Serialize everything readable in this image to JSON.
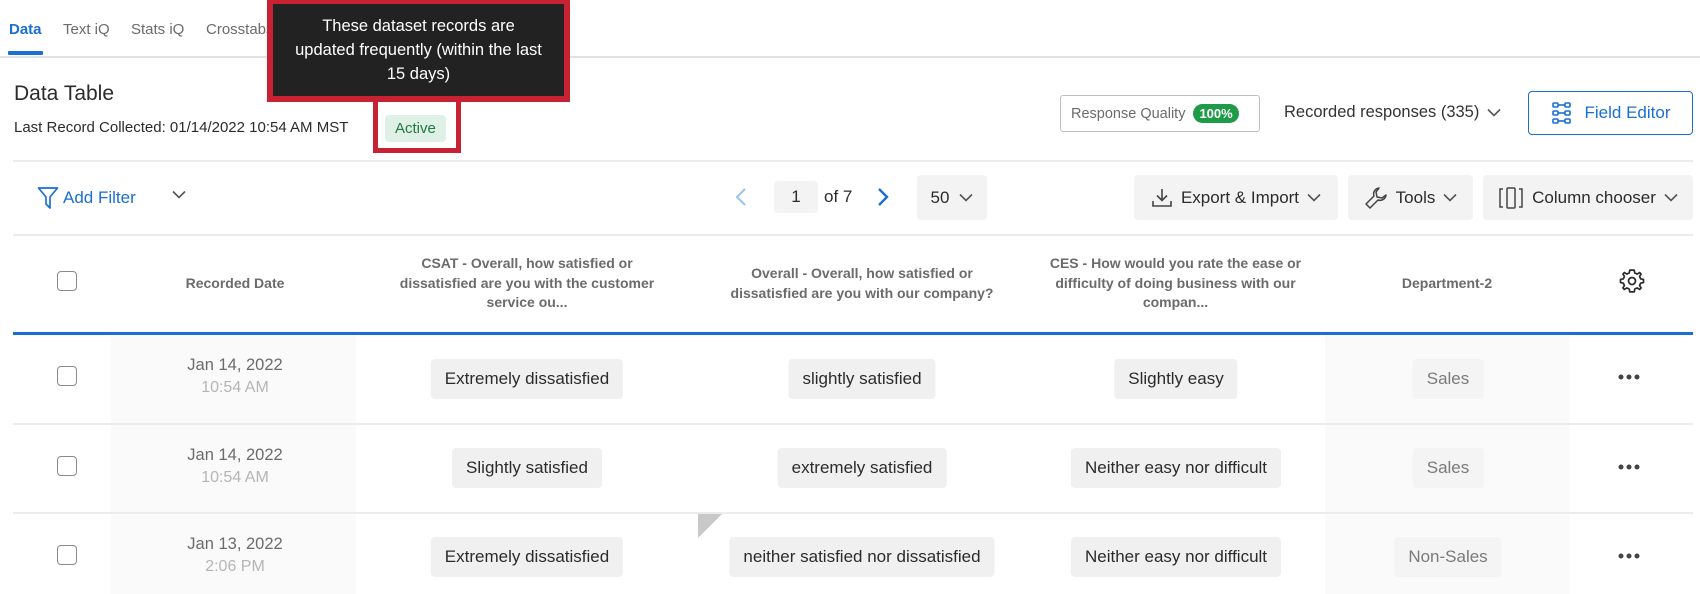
{
  "tabs": [
    {
      "label": "Data",
      "active": true
    },
    {
      "label": "Text iQ",
      "active": false
    },
    {
      "label": "Stats iQ",
      "active": false
    },
    {
      "label": "Crosstabs",
      "active": false
    }
  ],
  "header": {
    "title": "Data Table",
    "last_record": "Last Record Collected: 01/14/2022 10:54 AM MST",
    "status_badge": "Active",
    "response_quality_label": "Response Quality",
    "response_quality_value": "100%",
    "recorded_responses": "Recorded responses (335)",
    "field_editor": "Field Editor"
  },
  "tooltip": {
    "text": "These dataset records are updated frequently (within the last 15 days)"
  },
  "toolbar": {
    "add_filter": "Add Filter",
    "page_current": "1",
    "page_of": "of 7",
    "per_page": "50",
    "export_import": "Export & Import",
    "tools": "Tools",
    "column_chooser": "Column chooser"
  },
  "table": {
    "columns": [
      "Recorded Date",
      "CSAT - Overall, how satisfied or dissatisfied are you with the customer service ou...",
      "Overall - Overall, how satisfied or dissatisfied are you with our company?",
      "CES - How would you rate the ease or difficulty of doing business with our compan...",
      "Department-2"
    ],
    "rows": [
      {
        "date": "Jan 14, 2022",
        "time": "10:54 AM",
        "csat": "Extremely dissatisfied",
        "overall": "slightly satisfied",
        "ces": "Slightly easy",
        "dept": "Sales"
      },
      {
        "date": "Jan 14, 2022",
        "time": "10:54 AM",
        "csat": "Slightly satisfied",
        "overall": "extremely satisfied",
        "ces": "Neither easy nor difficult",
        "dept": "Sales"
      },
      {
        "date": "Jan 13, 2022",
        "time": "2:06 PM",
        "csat": "Extremely dissatisfied",
        "overall": "neither satisfied nor dissatisfied",
        "ces": "Neither easy nor difficult",
        "dept": "Non-Sales"
      }
    ]
  },
  "colors": {
    "accent": "#1a6fd1",
    "highlight": "#c62233",
    "active_badge_bg": "#dff0e6",
    "active_badge_text": "#1f7a3e",
    "quality_pill": "#1e9a48",
    "tooltip_bg": "#222222"
  }
}
